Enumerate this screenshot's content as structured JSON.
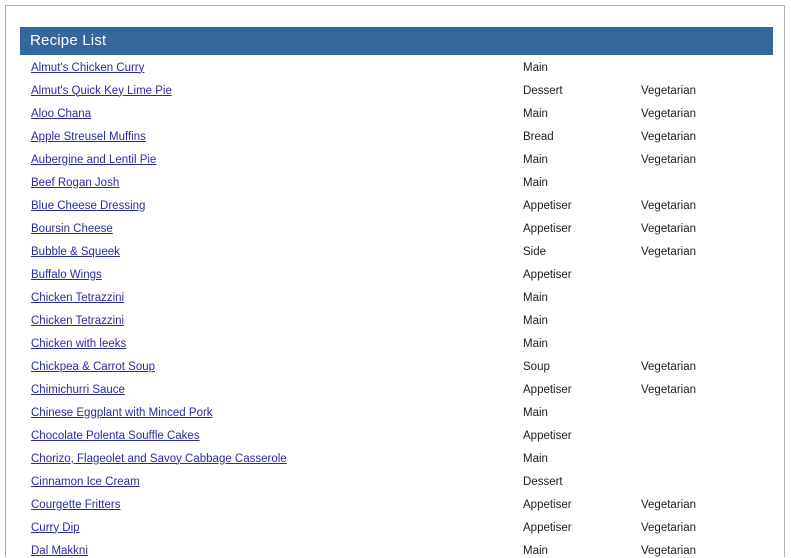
{
  "panel": {
    "title": "Recipe List",
    "header_bg": "#33679e",
    "header_text_color": "#ffffff",
    "link_color": "#2a2aa5"
  },
  "recipes": [
    {
      "name": "Almut's Chicken Curry",
      "category": "Main",
      "diet": ""
    },
    {
      "name": "Almut's Quick Key Lime Pie",
      "category": "Dessert",
      "diet": "Vegetarian"
    },
    {
      "name": "Aloo Chana",
      "category": "Main",
      "diet": "Vegetarian"
    },
    {
      "name": "Apple Streusel Muffins",
      "category": "Bread",
      "diet": "Vegetarian"
    },
    {
      "name": "Aubergine and Lentil Pie",
      "category": "Main",
      "diet": "Vegetarian"
    },
    {
      "name": "Beef Rogan Josh",
      "category": "Main",
      "diet": ""
    },
    {
      "name": "Blue Cheese Dressing",
      "category": "Appetiser",
      "diet": "Vegetarian"
    },
    {
      "name": "Boursin Cheese",
      "category": "Appetiser",
      "diet": "Vegetarian"
    },
    {
      "name": "Bubble & Squeek",
      "category": "Side",
      "diet": "Vegetarian"
    },
    {
      "name": "Buffalo Wings",
      "category": "Appetiser",
      "diet": ""
    },
    {
      "name": "Chicken Tetrazzini",
      "category": "Main",
      "diet": ""
    },
    {
      "name": "Chicken Tetrazzini",
      "category": "Main",
      "diet": ""
    },
    {
      "name": "Chicken with leeks",
      "category": "Main",
      "diet": ""
    },
    {
      "name": "Chickpea & Carrot Soup",
      "category": "Soup",
      "diet": "Vegetarian"
    },
    {
      "name": "Chimichurri Sauce",
      "category": "Appetiser",
      "diet": "Vegetarian"
    },
    {
      "name": "Chinese Eggplant with Minced Pork",
      "category": "Main",
      "diet": ""
    },
    {
      "name": "Chocolate Polenta Souffle Cakes",
      "category": "Appetiser",
      "diet": ""
    },
    {
      "name": "Chorizo, Flageolet and Savoy Cabbage Casserole",
      "category": "Main",
      "diet": ""
    },
    {
      "name": "Cinnamon Ice Cream",
      "category": "Dessert",
      "diet": ""
    },
    {
      "name": "Courgette Fritters",
      "category": "Appetiser",
      "diet": "Vegetarian"
    },
    {
      "name": "Curry Dip",
      "category": "Appetiser",
      "diet": "Vegetarian"
    },
    {
      "name": "Dal Makkni",
      "category": "Main",
      "diet": "Vegetarian"
    }
  ]
}
